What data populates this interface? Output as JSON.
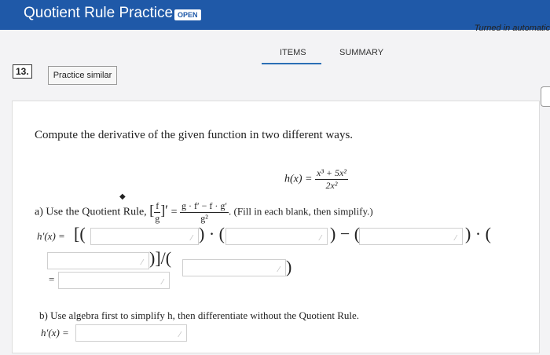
{
  "header": {
    "title": "Quotient Rule Practice",
    "badge": "OPEN",
    "status": "Turned in automatic"
  },
  "tabs": [
    {
      "label": "ITEMS"
    },
    {
      "label": "SUMMARY"
    }
  ],
  "question": {
    "number": "13.",
    "practice_label": "Practice similar"
  },
  "content": {
    "instruction": "Compute the derivative of the given function in two different ways.",
    "function_lhs": "h(x) =",
    "function_num": "x³ + 5x²",
    "function_den": "2x²",
    "part_a_prefix": "a) Use the Quotient Rule,",
    "quotient_f": "f",
    "quotient_g": "g",
    "quotient_eq": "=",
    "quotient_num": "g · f′ − f · g′",
    "quotient_den": "g²",
    "part_a_hint": ". (Fill in each blank, then simplify.)",
    "hprime_a": "h′(x) =",
    "sym_open": "[(",
    "sym_mid1": ") · (",
    "sym_mid2": ") − (",
    "sym_mid3": ") · (",
    "sym_close1": ")]/(",
    "sym_close2": ")",
    "equals": "=",
    "part_b": "b) Use algebra first to simplify h, then differentiate without the Quotient Rule.",
    "hprime_b": "h′(x) ="
  }
}
